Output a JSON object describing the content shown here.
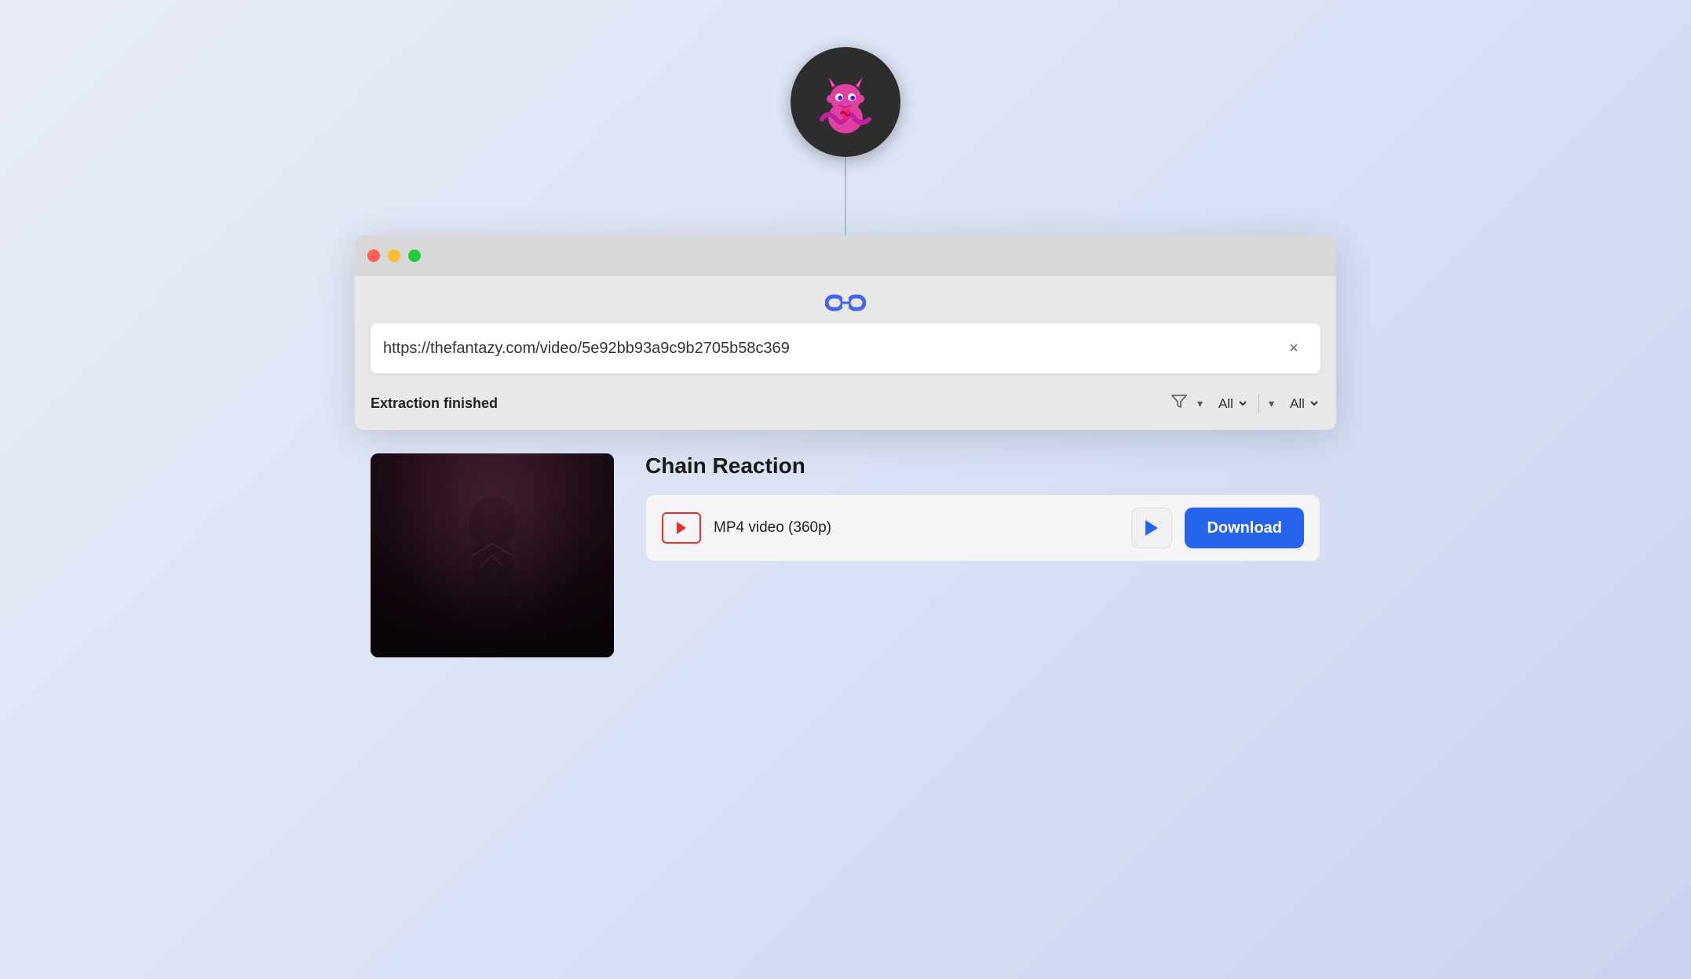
{
  "app": {
    "icon_alt": "Fantazy devil mascot"
  },
  "browser": {
    "traffic_lights": [
      {
        "color": "red",
        "label": "close"
      },
      {
        "color": "yellow",
        "label": "minimize"
      },
      {
        "color": "green",
        "label": "maximize"
      }
    ],
    "url_bar": {
      "value": "https://thefantazy.com/video/5e92bb93a9c9b2705b58c369",
      "placeholder": "Enter URL"
    },
    "clear_button_label": "×",
    "status": {
      "text": "Extraction finished"
    },
    "filters": {
      "filter_icon": "funnel",
      "option1": "All",
      "option2": "All"
    }
  },
  "content": {
    "video_title": "Chain Reaction",
    "format": {
      "type": "MP4 video (360p)",
      "icon": "play"
    },
    "buttons": {
      "preview_label": "▶",
      "download_label": "Download"
    }
  }
}
